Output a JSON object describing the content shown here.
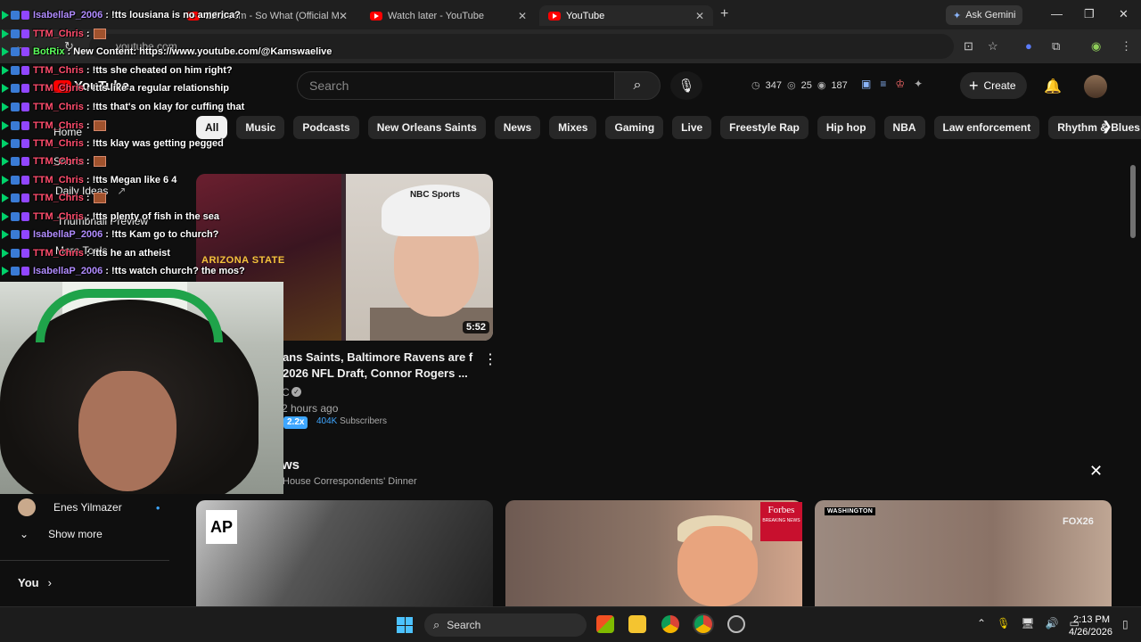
{
  "browser": {
    "tabs": [
      {
        "label": "Isabella_P_2006: !tts lousiana is no america?"
      },
      {
        "label": "EZ Deem - So What (Official M"
      },
      {
        "label": "Watch later - YouTube"
      },
      {
        "label": "YouTube"
      }
    ],
    "new_tab": "+",
    "gemini_label": "Ask Gemini",
    "url": "youtube.com"
  },
  "youtube": {
    "logo": "YouTube",
    "search_placeholder": "Search",
    "stats": {
      "a": "347",
      "b": "25",
      "c": "187"
    },
    "create_label": "Create",
    "chips": [
      "All",
      "Music",
      "Podcasts",
      "New Orleans Saints",
      "News",
      "Mixes",
      "Gaming",
      "Live",
      "Freestyle Rap",
      "Hip hop",
      "NBA",
      "Law enforcement",
      "Rhythm & Blues"
    ],
    "sidebar": {
      "home": "Home",
      "shorts": "Shorts",
      "daily_ideas": "Daily Ideas",
      "thumbnail_preview": "Thumbnail Preview",
      "more_tools": "More Tools",
      "subscription": "Enes Yilmazer",
      "show_more": "Show more",
      "you": "You"
    },
    "video": {
      "duration": "5:52",
      "title": "ans Saints, Baltimore Ravens are f 2026 NFL Draft, Connor Rogers ...",
      "channel": "C",
      "age": "2 hours ago",
      "speed": "2.2x",
      "subs_count": "404K",
      "subs_label": "Subscribers",
      "thumb_text_team": "ARIZONA STATE",
      "thumb_text_cap": "NBC Sports"
    },
    "shelf": {
      "title": "ws",
      "subtitle": "House Correspondents' Dinner",
      "ap": "AP",
      "forbes": "Forbes",
      "forbes_sub": "BREAKING NEWS",
      "wapo": "WASHINGTON",
      "fox": "FOX26"
    }
  },
  "chat": [
    {
      "user": "IsabellaP_2006",
      "color": "#b18cff",
      "msg": ": !tts lousiana is no america?",
      "emote": false
    },
    {
      "user": "TTM_Chris",
      "color": "#ff4d6d",
      "msg": " :",
      "emote": true
    },
    {
      "user": "BotRix",
      "color": "#5cff5c",
      "msg": ": New Content: https://www.youtube.com/@Kamswaelive",
      "emote": false
    },
    {
      "user": "TTM_Chris",
      "color": "#ff4d6d",
      "msg": ": !tts she cheated on him right?",
      "emote": false
    },
    {
      "user": "TTM_Chris",
      "color": "#ff4d6d",
      "msg": ": !tts like a regular relationship",
      "emote": false
    },
    {
      "user": "TTM_Chris",
      "color": "#ff4d6d",
      "msg": ": !tts that's on klay for cuffing that",
      "emote": false
    },
    {
      "user": "TTM_Chris",
      "color": "#ff4d6d",
      "msg": " :",
      "emote": true
    },
    {
      "user": "TTM_Chris",
      "color": "#ff4d6d",
      "msg": ": !tts klay was getting pegged",
      "emote": false
    },
    {
      "user": "TTM_Chris",
      "color": "#ff4d6d",
      "msg": " :",
      "emote": true
    },
    {
      "user": "TTM_Chris",
      "color": "#ff4d6d",
      "msg": ": !tts Megan like 6 4",
      "emote": false
    },
    {
      "user": "TTM_Chris",
      "color": "#ff4d6d",
      "msg": " :",
      "emote": true
    },
    {
      "user": "TTM_Chris",
      "color": "#ff4d6d",
      "msg": ": !tts plenty of fish in the sea",
      "emote": false
    },
    {
      "user": "IsabellaP_2006",
      "color": "#b18cff",
      "msg": ": !tts Kam go to church?",
      "emote": false
    },
    {
      "user": "TTM_Chris",
      "color": "#ff4d6d",
      "msg": ": !tts he an atheist",
      "emote": false
    },
    {
      "user": "IsabellaP_2006",
      "color": "#b18cff",
      "msg": ": !tts watch church? the mos?",
      "emote": false
    }
  ],
  "taskbar": {
    "search": "Search",
    "time": "2:13 PM",
    "date": "4/26/2026"
  }
}
